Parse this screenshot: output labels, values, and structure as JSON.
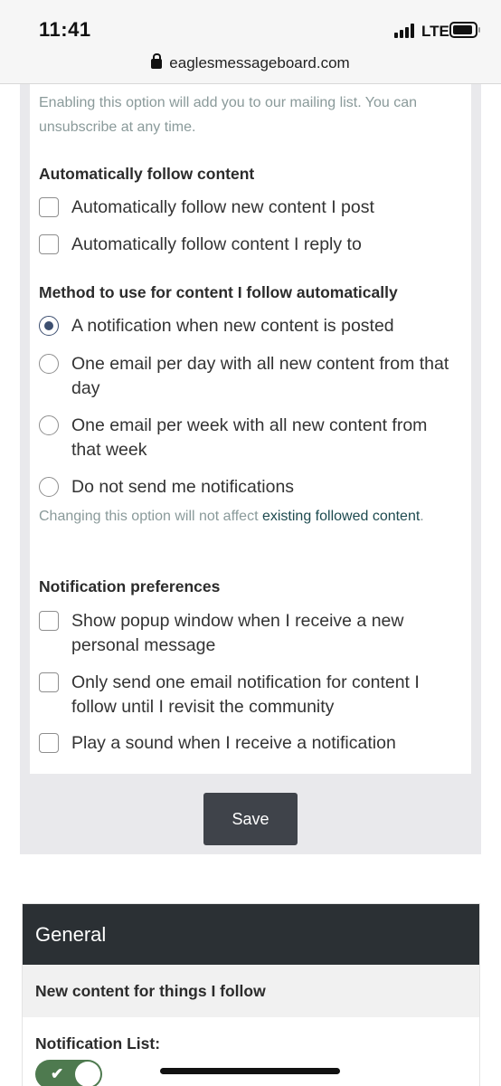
{
  "status_bar": {
    "time": "11:41",
    "network": "LTE"
  },
  "browser": {
    "url": "eaglesmessageboard.com"
  },
  "mailing_note": "Enabling this option will add you to our mailing list. You can unsubscribe at any time.",
  "auto_follow": {
    "heading": "Automatically follow content",
    "options": [
      {
        "label": "Automatically follow new content I post",
        "checked": false
      },
      {
        "label": "Automatically follow content I reply to",
        "checked": false
      }
    ]
  },
  "follow_method": {
    "heading": "Method to use for content I follow automatically",
    "options": [
      {
        "label": "A notification when new content is posted",
        "selected": true
      },
      {
        "label": "One email per day with all new content from that day",
        "selected": false
      },
      {
        "label": "One email per week with all new content from that week",
        "selected": false
      },
      {
        "label": "Do not send me notifications",
        "selected": false
      }
    ],
    "note_prefix": "Changing this option will not affect ",
    "note_link": "existing followed content",
    "note_suffix": "."
  },
  "notification_prefs": {
    "heading": "Notification preferences",
    "options": [
      {
        "label": "Show popup window when I receive a new personal message",
        "checked": false
      },
      {
        "label": "Only send one email notification for content I follow until I revisit the community",
        "checked": false
      },
      {
        "label": "Play a sound when I receive a notification",
        "checked": false
      }
    ]
  },
  "save_label": "Save",
  "general": {
    "title": "General",
    "subheading": "New content for things I follow",
    "list_label": "Notification List:",
    "toggle_on": true
  },
  "icons": {
    "lock": "lock-icon",
    "toggle_check": "check-icon"
  }
}
